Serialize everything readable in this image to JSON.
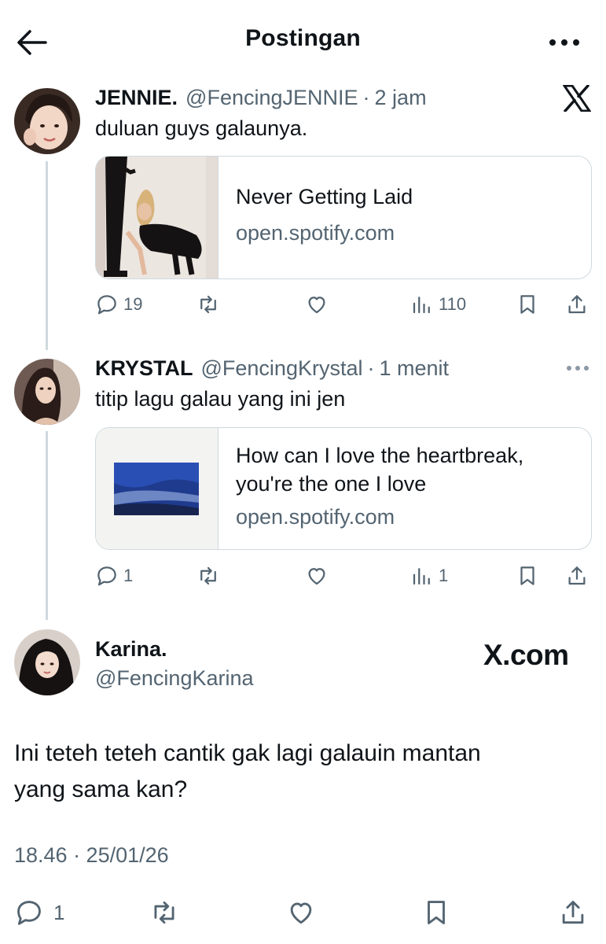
{
  "header": {
    "title": "Postingan",
    "back_icon": "arrow-left-icon",
    "more_icon": "more-horizontal-icon"
  },
  "tweets": [
    {
      "name": "JENNIE.",
      "handle": "@FencingJENNIE",
      "separator": "·",
      "time": "2 jam",
      "text": "duluan guys galaunya.",
      "badge_icon": "x-logo-icon",
      "card": {
        "title": "Never Getting Laid",
        "domain": "open.spotify.com"
      },
      "actions": {
        "replies": "19",
        "views": "110"
      }
    },
    {
      "name": "KRYSTAL",
      "handle": "@FencingKrystal",
      "separator": "·",
      "time": "1 menit",
      "text": "titip lagu galau yang ini jen",
      "card": {
        "title_line1": "How can I love the heartbreak,",
        "title_line2": "you're the one I love",
        "domain": "open.spotify.com"
      },
      "actions": {
        "replies": "1",
        "views": "1"
      }
    }
  ],
  "main_post": {
    "name": "Karina.",
    "handle": "@FencingKarina",
    "watermark": "X.com",
    "text_line1": "Ini teteh teteh cantik gak lagi galauin mantan",
    "text_line2": "yang sama kan?",
    "timestamp": "18.46 · 25/01/26",
    "actions": {
      "replies": "1"
    }
  },
  "colors": {
    "text": "#0f1419",
    "secondary": "#536471",
    "border": "#cfd9de"
  }
}
